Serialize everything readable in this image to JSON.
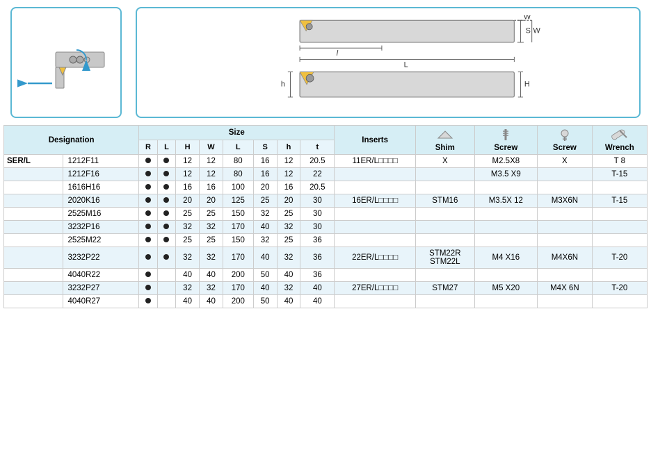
{
  "top": {
    "diagram_alt": "Turning tool diagram with screw clamp",
    "schematic_alt": "Tool schematic with dimensions S, W, L, l, H, h"
  },
  "table": {
    "headers": {
      "designation": "Designation",
      "size_group": "Size",
      "size_cols": [
        "R",
        "L",
        "H",
        "W",
        "L",
        "S",
        "h",
        "t"
      ],
      "inserts": "Inserts",
      "shim": "Shim",
      "screw1": "Screw",
      "screw2": "Screw",
      "wrench": "Wrench"
    },
    "rows": [
      {
        "group": "SER/L",
        "designation": "1212F11",
        "r": "●",
        "l": "●",
        "H": "12",
        "W": "12",
        "L": "80",
        "S": "16",
        "h": "12",
        "t": "20.5",
        "inserts": "11ER/L□□□□",
        "shim": "X",
        "screw1": "M2.5X8",
        "screw2": "X",
        "wrench": "T 8",
        "shade": false
      },
      {
        "group": "",
        "designation": "1212F16",
        "r": "●",
        "l": "●",
        "H": "12",
        "W": "12",
        "L": "80",
        "S": "16",
        "h": "12",
        "t": "22",
        "inserts": "",
        "shim": "",
        "screw1": "M3.5 X9",
        "screw2": "",
        "wrench": "T-15",
        "shade": true
      },
      {
        "group": "",
        "designation": "1616H16",
        "r": "●",
        "l": "●",
        "H": "16",
        "W": "16",
        "L": "100",
        "S": "20",
        "h": "16",
        "t": "20.5",
        "inserts": "",
        "shim": "",
        "screw1": "",
        "screw2": "",
        "wrench": "",
        "shade": false
      },
      {
        "group": "",
        "designation": "2020K16",
        "r": "●",
        "l": "●",
        "H": "20",
        "W": "20",
        "L": "125",
        "S": "25",
        "h": "20",
        "t": "30",
        "inserts": "16ER/L□□□□",
        "shim": "STM16",
        "screw1": "M3.5X 12",
        "screw2": "M3X6N",
        "wrench": "T-15",
        "shade": true
      },
      {
        "group": "",
        "designation": "2525M16",
        "r": "●",
        "l": "●",
        "H": "25",
        "W": "25",
        "L": "150",
        "S": "32",
        "h": "25",
        "t": "30",
        "inserts": "",
        "shim": "",
        "screw1": "",
        "screw2": "",
        "wrench": "",
        "shade": false
      },
      {
        "group": "",
        "designation": "3232P16",
        "r": "●",
        "l": "●",
        "H": "32",
        "W": "32",
        "L": "170",
        "S": "40",
        "h": "32",
        "t": "30",
        "inserts": "",
        "shim": "",
        "screw1": "",
        "screw2": "",
        "wrench": "",
        "shade": true
      },
      {
        "group": "",
        "designation": "2525M22",
        "r": "●",
        "l": "●",
        "H": "25",
        "W": "25",
        "L": "150",
        "S": "32",
        "h": "25",
        "t": "36",
        "inserts": "",
        "shim": "",
        "screw1": "",
        "screw2": "",
        "wrench": "",
        "shade": false
      },
      {
        "group": "",
        "designation": "3232P22",
        "r": "●",
        "l": "●",
        "H": "32",
        "W": "32",
        "L": "170",
        "S": "40",
        "h": "32",
        "t": "36",
        "inserts": "22ER/L□□□□",
        "shim": "STM22R\nSTM22L",
        "screw1": "M4 X16",
        "screw2": "M4X6N",
        "wrench": "T-20",
        "shade": true
      },
      {
        "group": "",
        "designation": "4040R22",
        "r": "●",
        "l": "",
        "H": "40",
        "W": "40",
        "L": "200",
        "S": "50",
        "h": "40",
        "t": "36",
        "inserts": "",
        "shim": "",
        "screw1": "",
        "screw2": "",
        "wrench": "",
        "shade": false
      },
      {
        "group": "",
        "designation": "3232P27",
        "r": "●",
        "l": "",
        "H": "32",
        "W": "32",
        "L": "170",
        "S": "40",
        "h": "32",
        "t": "40",
        "inserts": "27ER/L□□□□",
        "shim": "STM27",
        "screw1": "M5 X20",
        "screw2": "M4X 6N",
        "wrench": "T-20",
        "shade": true
      },
      {
        "group": "",
        "designation": "4040R27",
        "r": "●",
        "l": "",
        "H": "40",
        "W": "40",
        "L": "200",
        "S": "50",
        "h": "40",
        "t": "40",
        "inserts": "",
        "shim": "",
        "screw1": "",
        "screw2": "",
        "wrench": "",
        "shade": false
      }
    ]
  }
}
